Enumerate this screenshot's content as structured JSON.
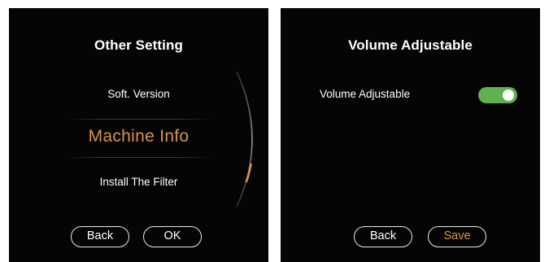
{
  "left_screen": {
    "title": "Other Setting",
    "menu": [
      {
        "label": "Soft. Version"
      },
      {
        "label": "Machine Info"
      },
      {
        "label": "Install The Filter"
      }
    ],
    "buttons": {
      "back": "Back",
      "ok": "OK"
    }
  },
  "right_screen": {
    "title": "Volume Adjustable",
    "setting": {
      "label": "Volume Adjustable",
      "enabled": true
    },
    "buttons": {
      "back": "Back",
      "save": "Save"
    }
  },
  "colors": {
    "background": "#050505",
    "selected_text": "#d4944a",
    "toggle_on": "#5fb04e",
    "text": "#ffffff"
  }
}
